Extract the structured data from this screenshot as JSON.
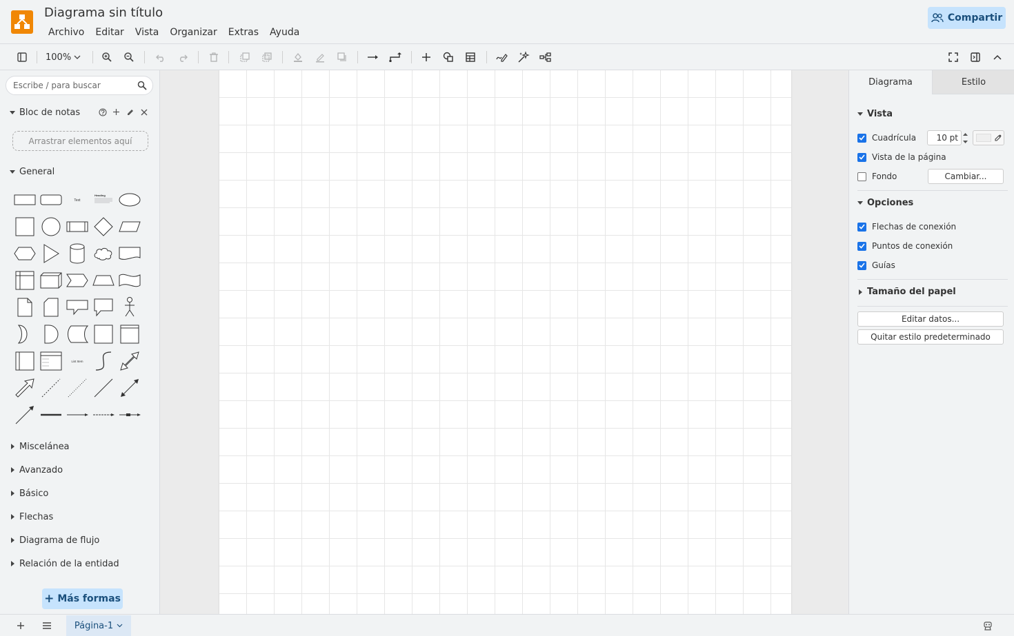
{
  "app": {
    "document_title": "Diagrama sin título",
    "menu": [
      "Archivo",
      "Editar",
      "Vista",
      "Organizar",
      "Extras",
      "Ayuda"
    ],
    "share_label": "Compartir",
    "accent_color": "#f08705"
  },
  "toolbar": {
    "zoom_level": "100%",
    "icons": [
      "sidebar-toggle-icon",
      "zoom-in-icon",
      "zoom-out-icon",
      "undo-icon",
      "redo-icon",
      "delete-icon",
      "to-front-icon",
      "to-back-icon",
      "fill-color-icon",
      "line-color-icon",
      "shadow-icon",
      "connection-icon",
      "waypoints-icon",
      "insert-icon",
      "shapes-icon",
      "table-icon",
      "freehand-icon",
      "magic-icon",
      "layout-icon",
      "fullscreen-icon",
      "format-panel-icon",
      "collapse-icon"
    ]
  },
  "left_panel": {
    "search_placeholder": "Escribe / para buscar",
    "scratchpad": {
      "title": "Bloc de notas",
      "drop_hint": "Arrastrar elementos aquí"
    },
    "general_title": "General",
    "shape_labels": {
      "text": "Text",
      "heading": "Heading",
      "list_item": "List Item"
    },
    "collapsed_sections": [
      "Miscelánea",
      "Avanzado",
      "Básico",
      "Flechas",
      "Diagrama de flujo",
      "Relación de la entidad"
    ],
    "more_shapes_label": "Más formas"
  },
  "right_panel": {
    "tabs": [
      "Diagrama",
      "Estilo"
    ],
    "view": {
      "title": "Vista",
      "grid_label": "Cuadrícula",
      "grid_checked": true,
      "grid_size": "10 pt",
      "page_view_label": "Vista de la página",
      "page_view_checked": true,
      "background_label": "Fondo",
      "background_checked": false,
      "change_label": "Cambiar..."
    },
    "options": {
      "title": "Opciones",
      "connection_arrows_label": "Flechas de conexión",
      "connection_points_label": "Puntos de conexión",
      "guides_label": "Guías"
    },
    "paper_size_title": "Tamaño del papel",
    "edit_data_label": "Editar datos...",
    "clear_style_label": "Quitar estilo predeterminado"
  },
  "footer": {
    "page_name": "Página-1"
  }
}
